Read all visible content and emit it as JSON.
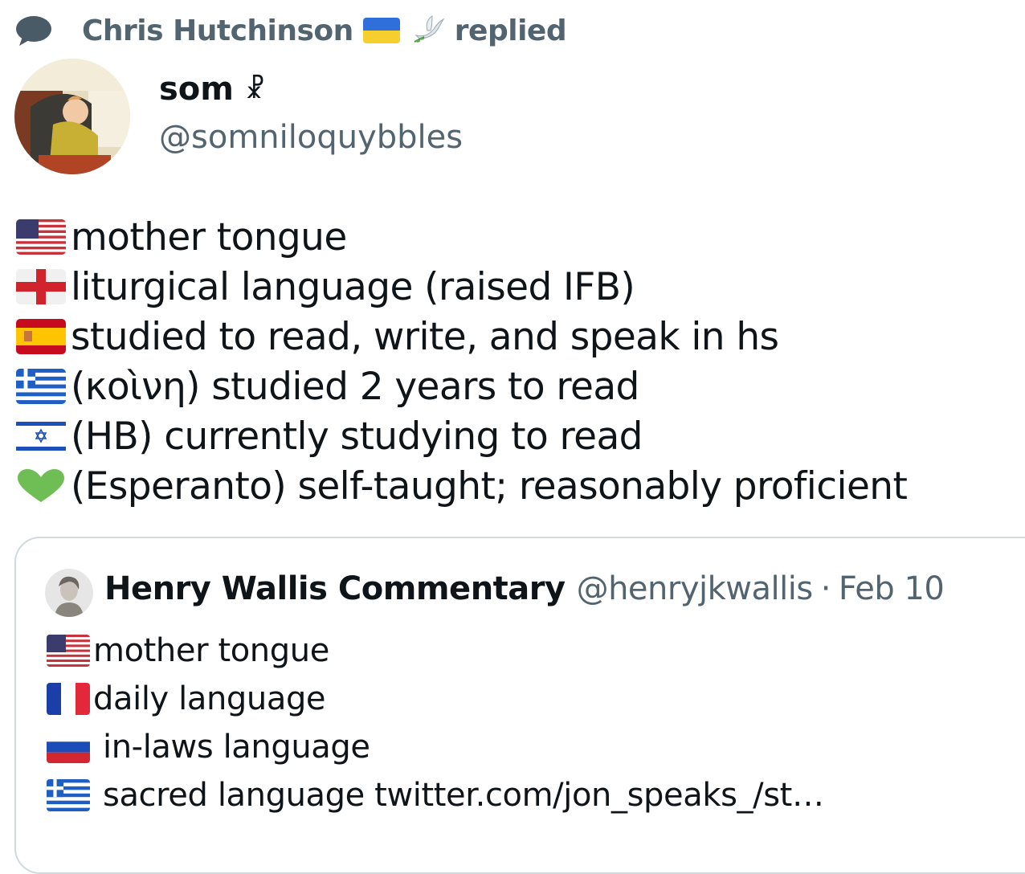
{
  "header": {
    "icon": "speech-bubble-icon",
    "author": "Chris Hutchinson",
    "flag": "ukraine-flag-icon",
    "dove": "dove-icon",
    "action": "replied"
  },
  "tweet": {
    "name": "som",
    "name_symbol": "☧",
    "handle": "@somniloquybbles",
    "lines": [
      {
        "icon": "us-flag-icon",
        "text": "mother tongue"
      },
      {
        "icon": "england-flag-icon",
        "text": "liturgical language (raised IFB)"
      },
      {
        "icon": "spain-flag-icon",
        "text": "studied to read, write, and speak in hs"
      },
      {
        "icon": "greece-flag-icon",
        "text": "(κοὶνη) studied 2 years to read"
      },
      {
        "icon": "israel-flag-icon",
        "text": "(HB) currently studying to read"
      },
      {
        "icon": "green-heart-icon",
        "text": "(Esperanto) self-taught; reasonably proficient"
      }
    ]
  },
  "quote": {
    "name": "Henry Wallis Commentary",
    "handle": "@henryjkwallis",
    "separator": "·",
    "date": "Feb 10",
    "lines": [
      {
        "icon": "us-flag-icon",
        "text": "mother tongue"
      },
      {
        "icon": "france-flag-icon",
        "text": "daily language"
      },
      {
        "icon": "russia-flag-icon",
        "text": "in-laws language"
      },
      {
        "icon": "greece-flag-icon",
        "text": "sacred language twitter.com/jon_speaks_/st…"
      }
    ]
  },
  "colors": {
    "primary_text": "#0f1419",
    "secondary_text": "#536471",
    "border": "#cfd9de"
  }
}
